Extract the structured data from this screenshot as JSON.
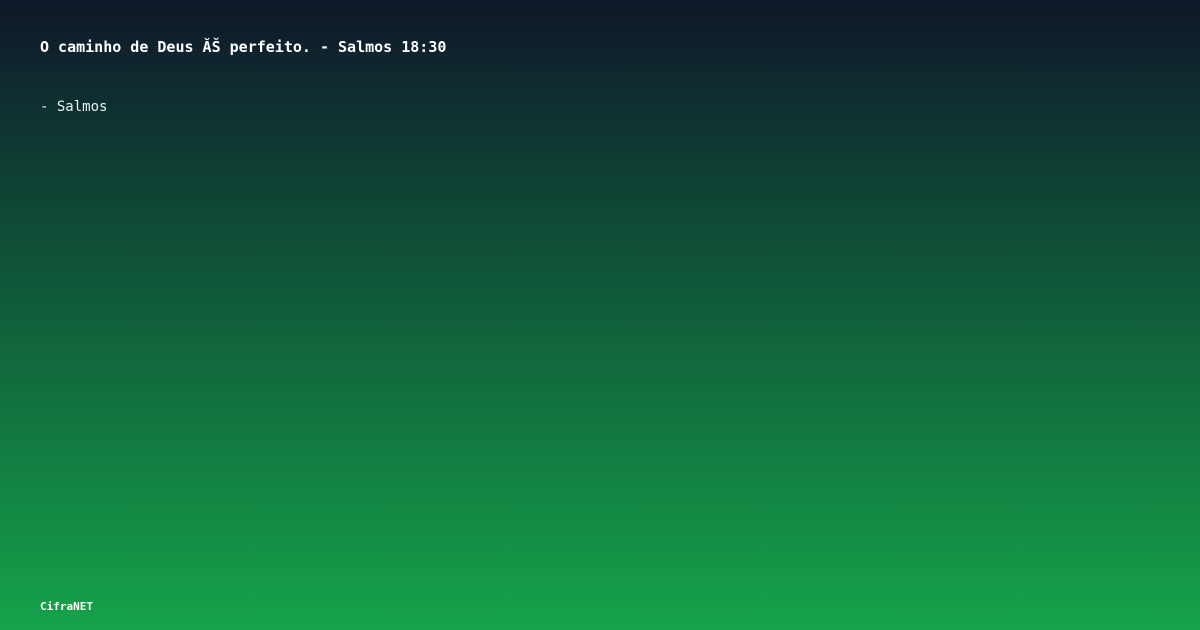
{
  "quote": {
    "text": "O caminho de Deus ĂŠ perfeito. - Salmos 18:30"
  },
  "author": {
    "text": "- Salmos"
  },
  "brand": {
    "name": "CifraNET"
  },
  "colors": {
    "gradient_top": "#0f172a",
    "gradient_mid": "#0f4a36",
    "gradient_bottom": "#16a34a",
    "text": "#ffffff"
  }
}
